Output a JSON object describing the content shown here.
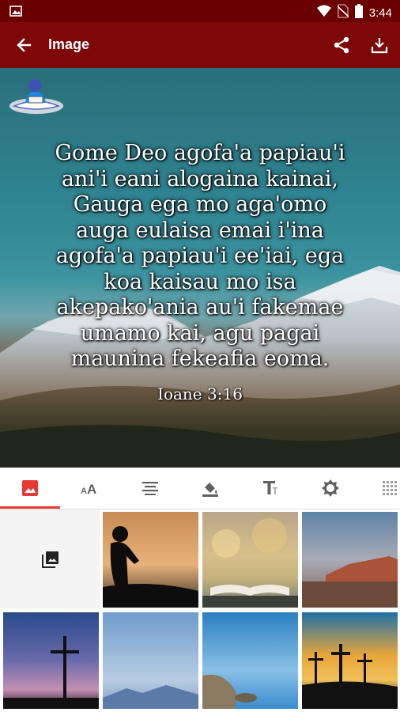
{
  "status_bar": {
    "time": "3:44",
    "icons": [
      "image-notification-icon",
      "wifi-icon",
      "no-sim-icon",
      "battery-icon"
    ]
  },
  "app_bar": {
    "title": "Image",
    "icons": [
      "back-arrow-icon",
      "share-icon",
      "download-icon"
    ],
    "color": "#7d0808"
  },
  "preview": {
    "verse_lines": [
      "Gome Deo agofa'a papiau'i",
      "ani'i eani alogaina kainai,",
      "Gauga ega mo aga'omo",
      "auga eulaisa emai i'ina",
      "agofa'a papiau'i ee'iai, ega",
      "koa kaisau mo isa",
      "akepako'ania au'i fakemae",
      "umamo kai, agu pagai",
      "maunina fekeafia eoma."
    ],
    "reference": "Ioane 3:16",
    "logo_icon": "bible-reader-logo-icon"
  },
  "tabs": [
    {
      "name": "background",
      "icon": "image-icon",
      "active": true
    },
    {
      "name": "font",
      "icon": "font-size-icon",
      "active": false
    },
    {
      "name": "align",
      "icon": "align-center-icon",
      "active": false
    },
    {
      "name": "color",
      "icon": "paint-bucket-icon",
      "active": false
    },
    {
      "name": "text-style",
      "icon": "text-format-icon",
      "active": false
    },
    {
      "name": "brightness",
      "icon": "brightness-icon",
      "active": false
    },
    {
      "name": "texture",
      "icon": "texture-icon",
      "active": false
    }
  ],
  "accent_color": "#e53935",
  "backgrounds": [
    {
      "name": "pick-from-gallery",
      "icon": "photo-library-icon"
    },
    {
      "name": "silhouette-reading-sunset"
    },
    {
      "name": "open-book-bokeh"
    },
    {
      "name": "desert-mountain-dusk"
    },
    {
      "name": "cross-purple-sky"
    },
    {
      "name": "blue-mountains-mist"
    },
    {
      "name": "blue-lake-rocks"
    },
    {
      "name": "three-crosses-sunset"
    }
  ]
}
